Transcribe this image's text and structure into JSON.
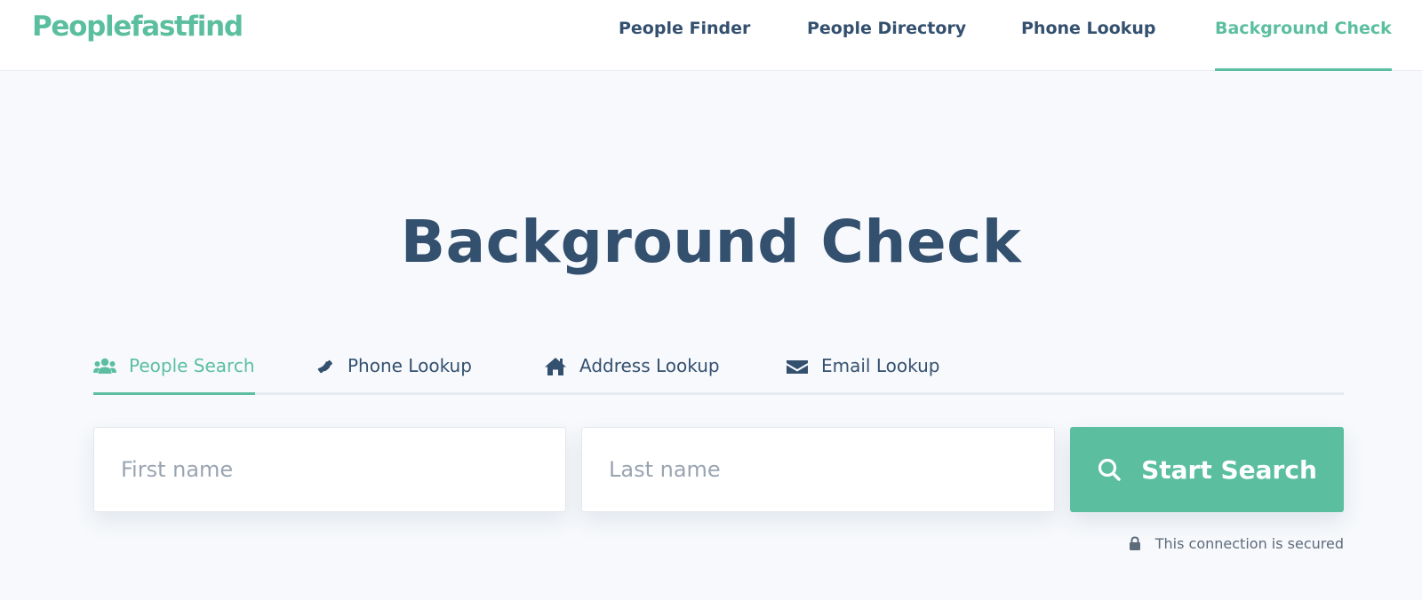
{
  "brand": {
    "logo_text": "Peoplefastfind",
    "accent_color": "#5bbf9f",
    "text_color": "#34506f"
  },
  "nav": {
    "items": [
      {
        "label": "People Finder",
        "active": false
      },
      {
        "label": "People Directory",
        "active": false
      },
      {
        "label": "Phone Lookup",
        "active": false
      },
      {
        "label": "Background Check",
        "active": true
      }
    ]
  },
  "hero": {
    "title": "Background Check"
  },
  "search_tabs": [
    {
      "label": "People Search",
      "icon": "people-icon",
      "active": true
    },
    {
      "label": "Phone Lookup",
      "icon": "phone-icon",
      "active": false
    },
    {
      "label": "Address Lookup",
      "icon": "home-icon",
      "active": false
    },
    {
      "label": "Email Lookup",
      "icon": "envelope-icon",
      "active": false
    }
  ],
  "search_form": {
    "first_name": {
      "value": "",
      "placeholder": "First name"
    },
    "last_name": {
      "value": "",
      "placeholder": "Last name"
    },
    "submit_label": "Start Search",
    "submit_icon": "search-icon"
  },
  "security_note": {
    "text": "This connection is secured",
    "icon": "lock-icon"
  }
}
